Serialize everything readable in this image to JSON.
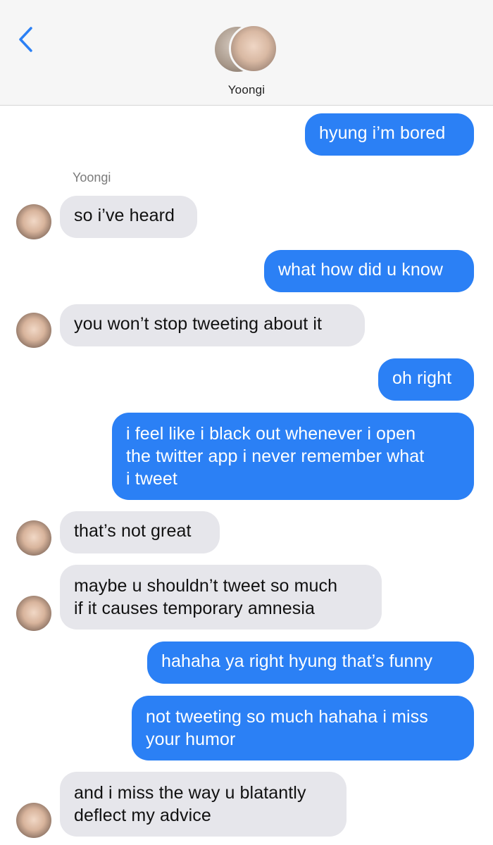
{
  "header": {
    "contact_name": "Yoongi",
    "back_icon": "chevron-left-icon",
    "accent_color": "#2b80f5"
  },
  "thread": {
    "sender_label": "Yoongi",
    "messages": [
      {
        "from": "me",
        "text": "hyung i’m bored"
      },
      {
        "from": "them",
        "text": "so i’ve heard"
      },
      {
        "from": "me",
        "text": "what how did u know"
      },
      {
        "from": "them",
        "text": "you won’t stop tweeting about it"
      },
      {
        "from": "me",
        "text": "oh right"
      },
      {
        "from": "me",
        "lines": [
          "i feel like i black out whenever i open",
          "the twitter app i never remember what",
          "i tweet"
        ]
      },
      {
        "from": "them",
        "text": "that’s not great"
      },
      {
        "from": "them",
        "lines": [
          "maybe u shouldn’t tweet so much",
          "if it causes temporary amnesia"
        ]
      },
      {
        "from": "me",
        "text": "hahaha ya right hyung that’s funny"
      },
      {
        "from": "me",
        "lines": [
          "not tweeting so much hahaha i miss",
          "your humor"
        ]
      },
      {
        "from": "them",
        "lines": [
          "and i miss the way u blatantly",
          "deflect my advice"
        ]
      }
    ]
  }
}
